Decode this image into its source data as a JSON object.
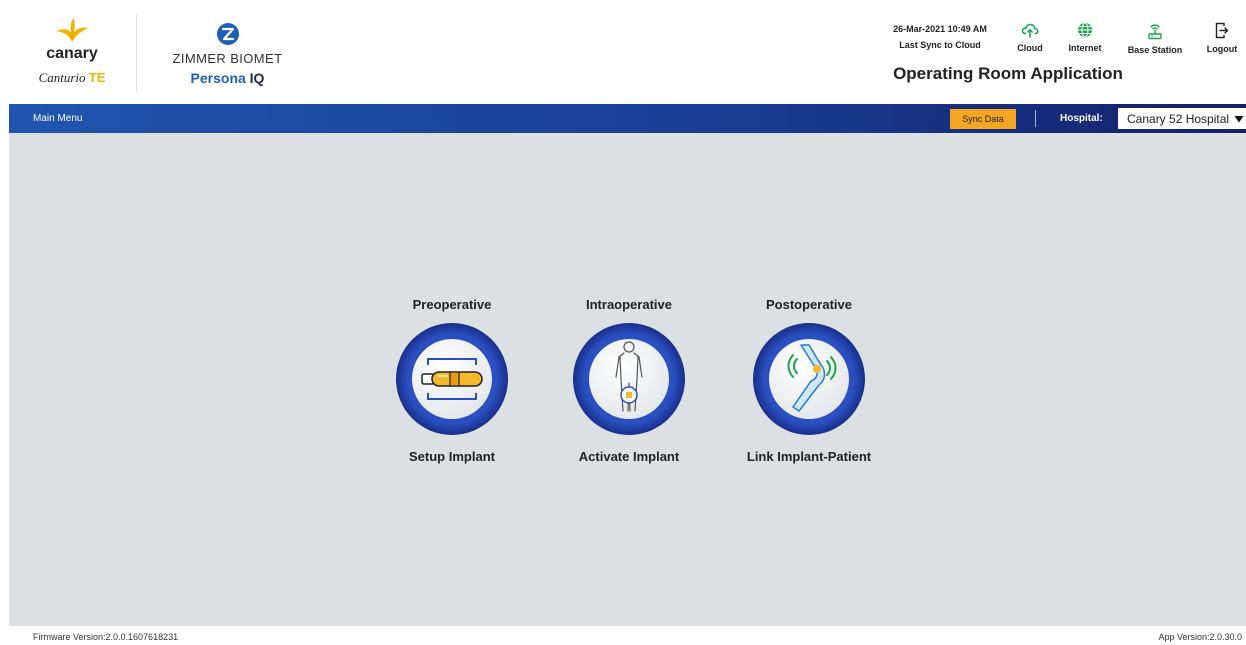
{
  "header": {
    "canary_brand": "canary",
    "canary_product": "Canturio",
    "canary_product_suffix": "TE",
    "zimmer_name": "ZIMMER BIOMET",
    "persona_name": "Persona",
    "persona_suffix": "IQ",
    "datetime": "26-Mar-2021 10:49 AM",
    "last_sync": "Last Sync to Cloud",
    "app_title": "Operating Room Application",
    "status": {
      "cloud": "Cloud",
      "internet": "Internet",
      "base_station": "Base Station",
      "logout": "Logout"
    }
  },
  "navbar": {
    "main_menu": "Main Menu",
    "sync_button": "Sync Data",
    "hospital_label": "Hospital:",
    "hospital_value": "Canary 52 Hospital"
  },
  "tiles": [
    {
      "title": "Preoperative",
      "action": "Setup Implant"
    },
    {
      "title": "Intraoperative",
      "action": "Activate Implant"
    },
    {
      "title": "Postoperative",
      "action": "Link Implant-Patient"
    }
  ],
  "footer": {
    "firmware": "Firmware Version:2.0.0.1607618231",
    "app_version": "App Version:2.0.30.0"
  },
  "colors": {
    "nav_blue_start": "#1f55b0",
    "nav_blue_end": "#141f6a",
    "sync_orange": "#f5a623",
    "content_bg": "#dce0e3",
    "icon_ring": "#1f3fa6",
    "status_green": "#19a34a",
    "canary_yellow": "#f0b400"
  },
  "icons": {
    "canary": "canary-bird-icon",
    "zimmer": "zimmer-z-icon",
    "cloud": "cloud-upload-icon",
    "internet": "globe-icon",
    "base_station": "base-station-icon",
    "logout": "logout-icon",
    "preop": "implant-device-icon",
    "intraop": "body-outline-icon",
    "postop": "knee-signal-icon"
  }
}
